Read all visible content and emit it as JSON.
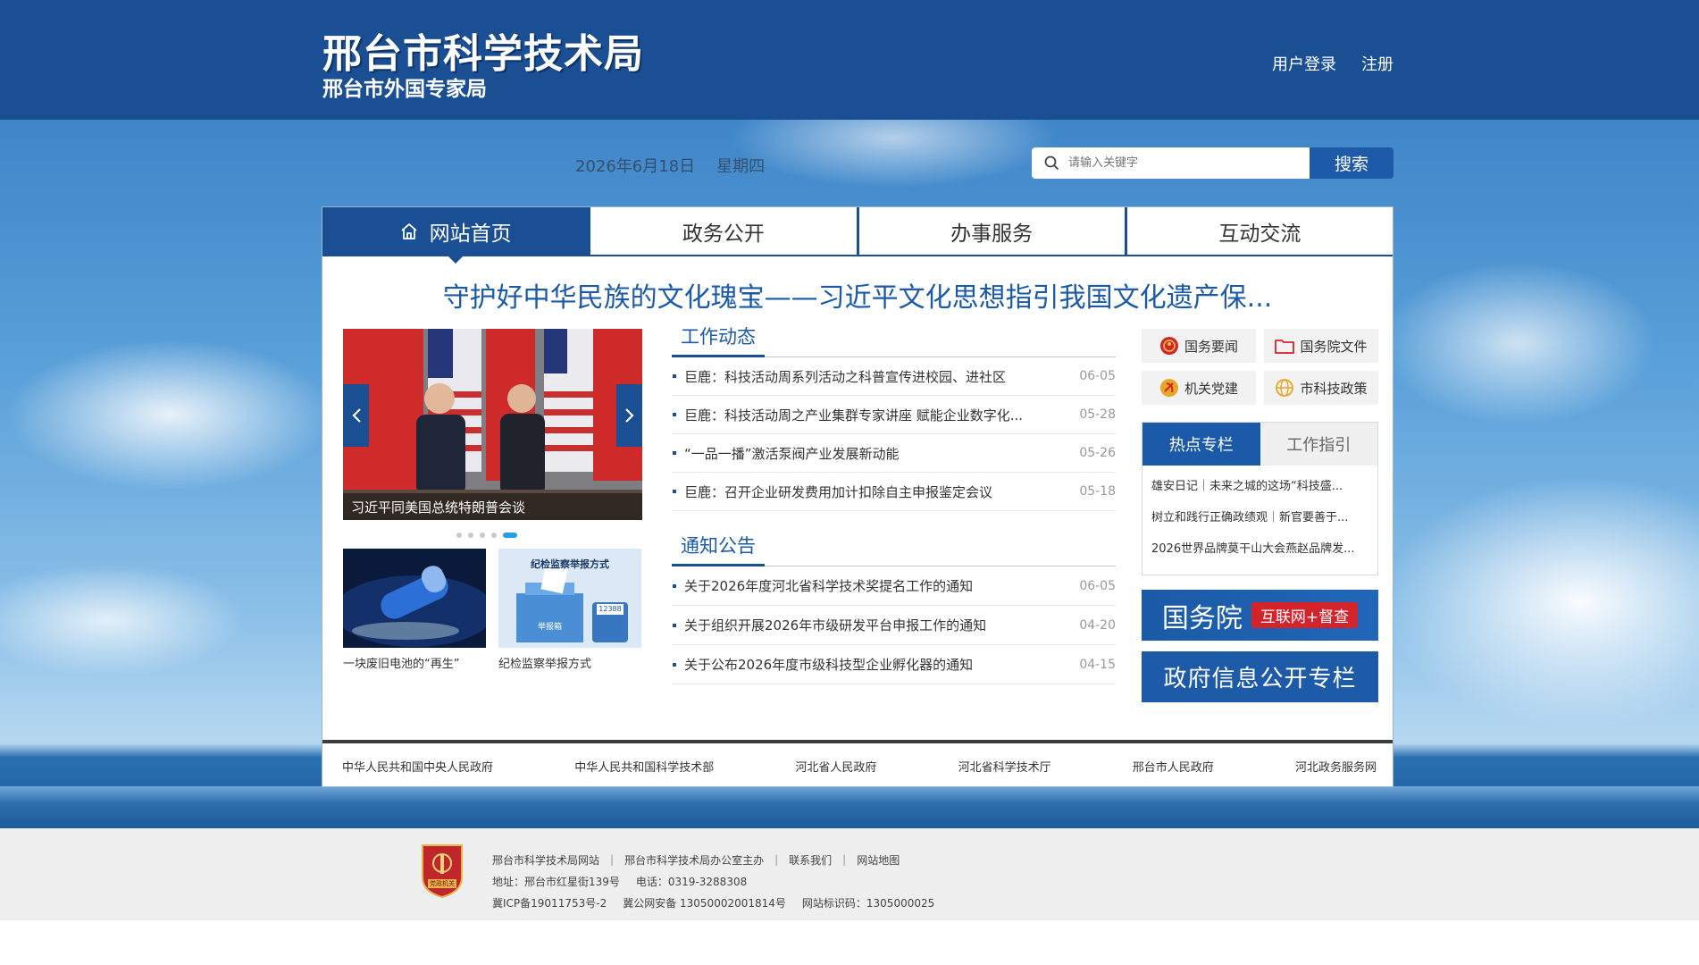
{
  "header": {
    "title": "邢台市科学技术局",
    "subtitle": "邢台市外国专家局",
    "login": "用户登录",
    "register": "注册"
  },
  "date": {
    "date": "2026年6月18日",
    "weekday": "星期四"
  },
  "search": {
    "placeholder": "请输入关键字",
    "button": "搜索"
  },
  "nav": {
    "items": [
      {
        "label": "网站首页",
        "active": true
      },
      {
        "label": "政务公开"
      },
      {
        "label": "办事服务"
      },
      {
        "label": "互动交流"
      }
    ]
  },
  "headline": "守护好中华民族的文化瑰宝——习近平文化思想指引我国文化遗产保...",
  "carousel": {
    "caption": "习近平同美国总统特朗普会谈",
    "dots": 5,
    "active_dot": 4
  },
  "thumbs": [
    {
      "caption": "一块废旧电池的“再生”"
    },
    {
      "caption": "纪检监察举报方式",
      "image_text": "纪检监察举报方式",
      "label": "举报箱",
      "phone": "12388"
    }
  ],
  "work_news": {
    "title": "工作动态",
    "items": [
      {
        "text": "巨鹿：科技活动周系列活动之科普宣传进校园、进社区",
        "date": "06-05"
      },
      {
        "text": "巨鹿：科技活动周之产业集群专家讲座 赋能企业数字化...",
        "date": "05-28"
      },
      {
        "text": "“一品一播”激活泵阀产业发展新动能",
        "date": "05-26"
      },
      {
        "text": "巨鹿：召开企业研发费用加计扣除自主申报鉴定会议",
        "date": "05-18"
      }
    ]
  },
  "notices": {
    "title": "通知公告",
    "items": [
      {
        "text": "关于2026年度河北省科学技术奖提名工作的通知",
        "date": "06-05"
      },
      {
        "text": "关于组织开展2026年市级研发平台申报工作的通知",
        "date": "04-20"
      },
      {
        "text": "关于公布2026年度市级科技型企业孵化器的通知",
        "date": "04-15"
      }
    ]
  },
  "quick_links": [
    {
      "label": "国务要闻",
      "icon": "emblem-icon"
    },
    {
      "label": "国务院文件",
      "icon": "folder-icon"
    },
    {
      "label": "机关党建",
      "icon": "party-icon"
    },
    {
      "label": "市科技政策",
      "icon": "globe-icon"
    }
  ],
  "tabs": {
    "items": [
      {
        "label": "热点专栏",
        "active": true
      },
      {
        "label": "工作指引"
      }
    ],
    "list": [
      "雄安日记｜未来之城的这场“科技盛...",
      "树立和践行正确政绩观｜新官要善于...",
      "2026世界品牌莫干山大会燕赵品牌发..."
    ]
  },
  "banners": {
    "gov_main": "国务院",
    "gov_tag": "互联网+督查",
    "info": "政府信息公开专栏"
  },
  "footer_links": [
    "中华人民共和国中央人民政府",
    "中华人民共和国科学技术部",
    "河北省人民政府",
    "河北省科学技术厅",
    "邢台市人民政府",
    "河北政务服务网"
  ],
  "footer": {
    "emblem_text": "党政机关",
    "links": [
      "邢台市科学技术局网站",
      "邢台市科学技术局办公室主办",
      "联系我们",
      "网站地图"
    ],
    "address": "地址：邢台市红星街139号",
    "phone": "电话：0319-3288308",
    "icp": "冀ICP备19011753号-2",
    "police": "冀公网安备 13050002001814号",
    "site_code": "网站标识码：1305000025"
  },
  "colors": {
    "primary": "#1a4f94",
    "accent": "#1a5aa8",
    "tag_red": "#d3232b",
    "dot_active": "#22a0e0"
  }
}
